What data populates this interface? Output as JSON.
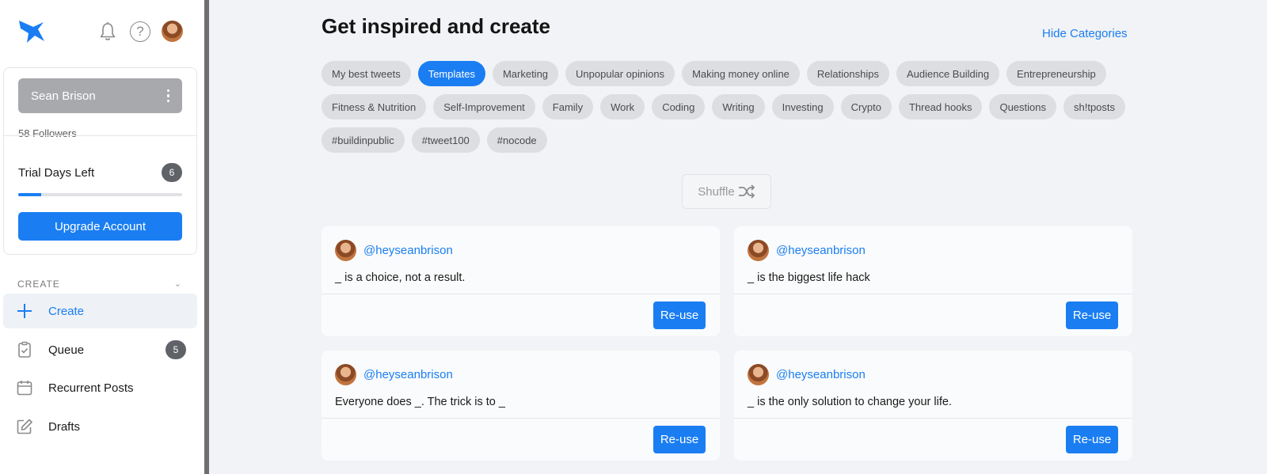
{
  "sidebar": {
    "user_name": "Sean Brison",
    "followers": "58 Followers",
    "trial_label": "Trial Days Left",
    "trial_days": "6",
    "trial_progress": 0.14,
    "upgrade_label": "Upgrade Account",
    "section_title": "CREATE",
    "nav": [
      {
        "label": "Create",
        "icon": "plus-icon",
        "badge": null,
        "active": true
      },
      {
        "label": "Queue",
        "icon": "clipboard-check-icon",
        "badge": "5",
        "active": false
      },
      {
        "label": "Recurrent Posts",
        "icon": "calendar-icon",
        "badge": null,
        "active": false
      },
      {
        "label": "Drafts",
        "icon": "edit-icon",
        "badge": null,
        "active": false
      }
    ]
  },
  "header": {
    "help_glyph": "?",
    "chevron_glyph": "⌄"
  },
  "main": {
    "title": "Get inspired and create",
    "hide_categories": "Hide Categories",
    "categories": [
      {
        "label": "My best tweets",
        "active": false
      },
      {
        "label": "Templates",
        "active": true
      },
      {
        "label": "Marketing",
        "active": false
      },
      {
        "label": "Unpopular opinions",
        "active": false
      },
      {
        "label": "Making money online",
        "active": false
      },
      {
        "label": "Relationships",
        "active": false
      },
      {
        "label": "Audience Building",
        "active": false
      },
      {
        "label": "Entrepreneurship",
        "active": false
      },
      {
        "label": "Fitness & Nutrition",
        "active": false
      },
      {
        "label": "Self-Improvement",
        "active": false
      },
      {
        "label": "Family",
        "active": false
      },
      {
        "label": "Work",
        "active": false
      },
      {
        "label": "Coding",
        "active": false
      },
      {
        "label": "Writing",
        "active": false
      },
      {
        "label": "Investing",
        "active": false
      },
      {
        "label": "Crypto",
        "active": false
      },
      {
        "label": "Thread hooks",
        "active": false
      },
      {
        "label": "Questions",
        "active": false
      },
      {
        "label": "sh!tposts",
        "active": false
      },
      {
        "label": "#buildinpublic",
        "active": false
      },
      {
        "label": "#tweet100",
        "active": false
      },
      {
        "label": "#nocode",
        "active": false
      }
    ],
    "shuffle_label": "Shuffle",
    "cards": [
      {
        "handle": "@heyseanbrison",
        "text": "_ is a choice, not a result.",
        "action": "Re-use"
      },
      {
        "handle": "@heyseanbrison",
        "text": "_ is the biggest life hack",
        "action": "Re-use"
      },
      {
        "handle": "@heyseanbrison",
        "text": "Everyone does _. The trick is to _",
        "action": "Re-use"
      },
      {
        "handle": "@heyseanbrison",
        "text": "_ is the only solution to change your life.",
        "action": "Re-use"
      }
    ]
  },
  "colors": {
    "accent": "#1a7ef2",
    "chip": "#dcdee2",
    "badge": "#5f6266"
  }
}
